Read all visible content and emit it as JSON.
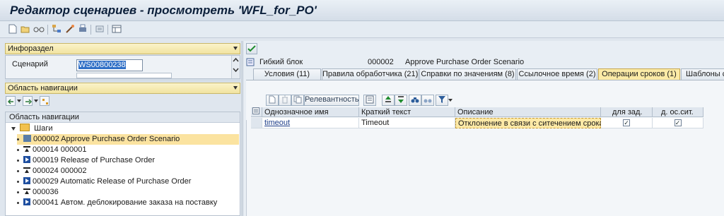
{
  "window": {
    "title": "Редактор сценариев - просмотреть 'WFL_for_PO'"
  },
  "toolbar": {
    "icons": [
      "new-document-icon",
      "open-icon",
      "glasses-icon",
      "hierarchy-icon",
      "magic-wand-icon",
      "print-icon",
      "find-icon",
      "layout-icon"
    ]
  },
  "left": {
    "info_section": "Инфораздел",
    "scenario_label": "Сценарий",
    "scenario_value": "WS00800238",
    "nav_section": "Область навигации",
    "nav_tree_header": "Область навигации",
    "tree_root": "Шаги",
    "tree_items": [
      {
        "icon": "scenario-icon",
        "label": "000002 Approve Purchase Order Scenario",
        "selected": true
      },
      {
        "icon": "wait-icon",
        "label": "000014 000001"
      },
      {
        "icon": "activity-icon",
        "label": "000019 Release of Purchase Order"
      },
      {
        "icon": "wait-icon",
        "label": "000024 000002"
      },
      {
        "icon": "activity-icon",
        "label": "000029 Automatic Release of Purchase Order"
      },
      {
        "icon": "wait-icon",
        "label": "000036"
      },
      {
        "icon": "activity-icon",
        "label": "000041 Автом. деблокирование заказа на поставку"
      }
    ]
  },
  "right": {
    "block_label": "Гибкий блок",
    "block_number": "000002",
    "block_name": "Approve Purchase Order Scenario",
    "tabs": [
      {
        "label": "Условия (11)"
      },
      {
        "label": "Правила обработчика (21)"
      },
      {
        "label": "Справки по значениям (8)"
      },
      {
        "label": "Ссылочное время (2)"
      },
      {
        "label": "Операции сроков (1)",
        "active": true
      },
      {
        "label": "Шаблоны со"
      }
    ],
    "relevance_button": "Релевантность",
    "table": {
      "headers": [
        "Однозначное имя",
        "Краткий текст",
        "Описание",
        "для зад.",
        "д. ос.сит."
      ],
      "rows": [
        {
          "name": "timeout",
          "short_text": "Timeout",
          "description": "Отклонение в связи с ситечением срока",
          "task": true,
          "system": true
        }
      ]
    }
  },
  "colors": {
    "accent_yellow": "#fbeaa6",
    "selection_blue": "#3271c7",
    "frame": "#dfe6ee"
  }
}
